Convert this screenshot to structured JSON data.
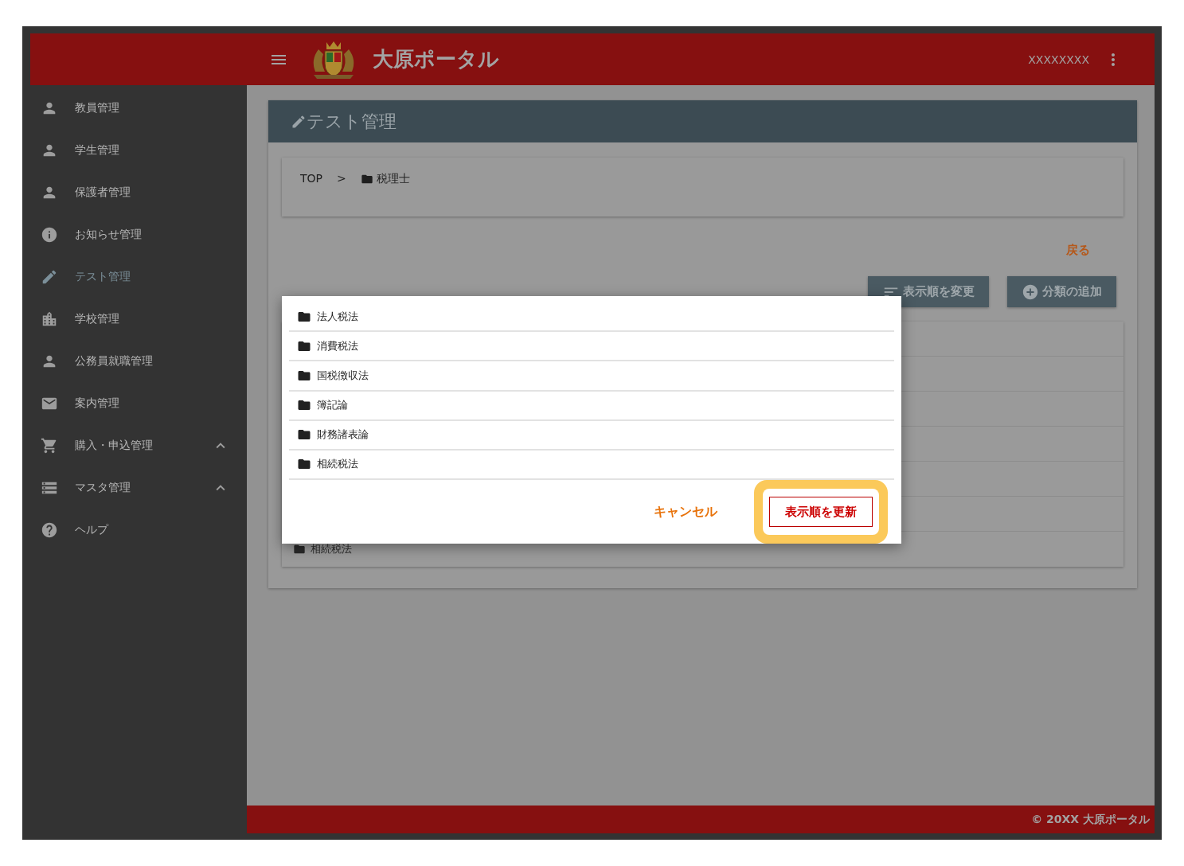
{
  "header": {
    "title": "大原ポータル",
    "user": "XXXXXXXX"
  },
  "sidebar": {
    "items": [
      {
        "label": "教員管理",
        "kind": "link",
        "selected": false
      },
      {
        "label": "学生管理",
        "kind": "link",
        "selected": false
      },
      {
        "label": "保護者管理",
        "kind": "link",
        "selected": false
      },
      {
        "label": "お知らせ管理",
        "kind": "link",
        "selected": false
      },
      {
        "label": "テスト管理",
        "kind": "link",
        "selected": true
      },
      {
        "label": "学校管理",
        "kind": "link",
        "selected": false
      },
      {
        "label": "公務員就職管理",
        "kind": "link",
        "selected": false
      },
      {
        "label": "案内管理",
        "kind": "link",
        "selected": false
      },
      {
        "label": "購入・申込管理",
        "kind": "group",
        "selected": false
      },
      {
        "label": "マスタ管理",
        "kind": "group",
        "selected": false
      },
      {
        "label": "ヘルプ",
        "kind": "link",
        "selected": false
      }
    ]
  },
  "page": {
    "title": "テスト管理",
    "breadcrumb": {
      "root": "TOP",
      "separator": ">",
      "current": "税理士"
    },
    "back_link": "戻る",
    "actions": [
      {
        "label": "表示順を変更"
      },
      {
        "label": "分類の追加"
      }
    ],
    "list": {
      "rows": [
        {
          "label": "相続税法"
        }
      ]
    }
  },
  "dialog": {
    "items": [
      {
        "label": "法人税法"
      },
      {
        "label": "消費税法"
      },
      {
        "label": "国税徴収法"
      },
      {
        "label": "簿記論"
      },
      {
        "label": "財務諸表論"
      },
      {
        "label": "相続税法"
      }
    ],
    "cancel": "キャンセル",
    "confirm": {
      "label": "表示順を更新",
      "highlighted": true
    }
  },
  "footer": {
    "copyright": "© 20XX 大原ポータル"
  }
}
